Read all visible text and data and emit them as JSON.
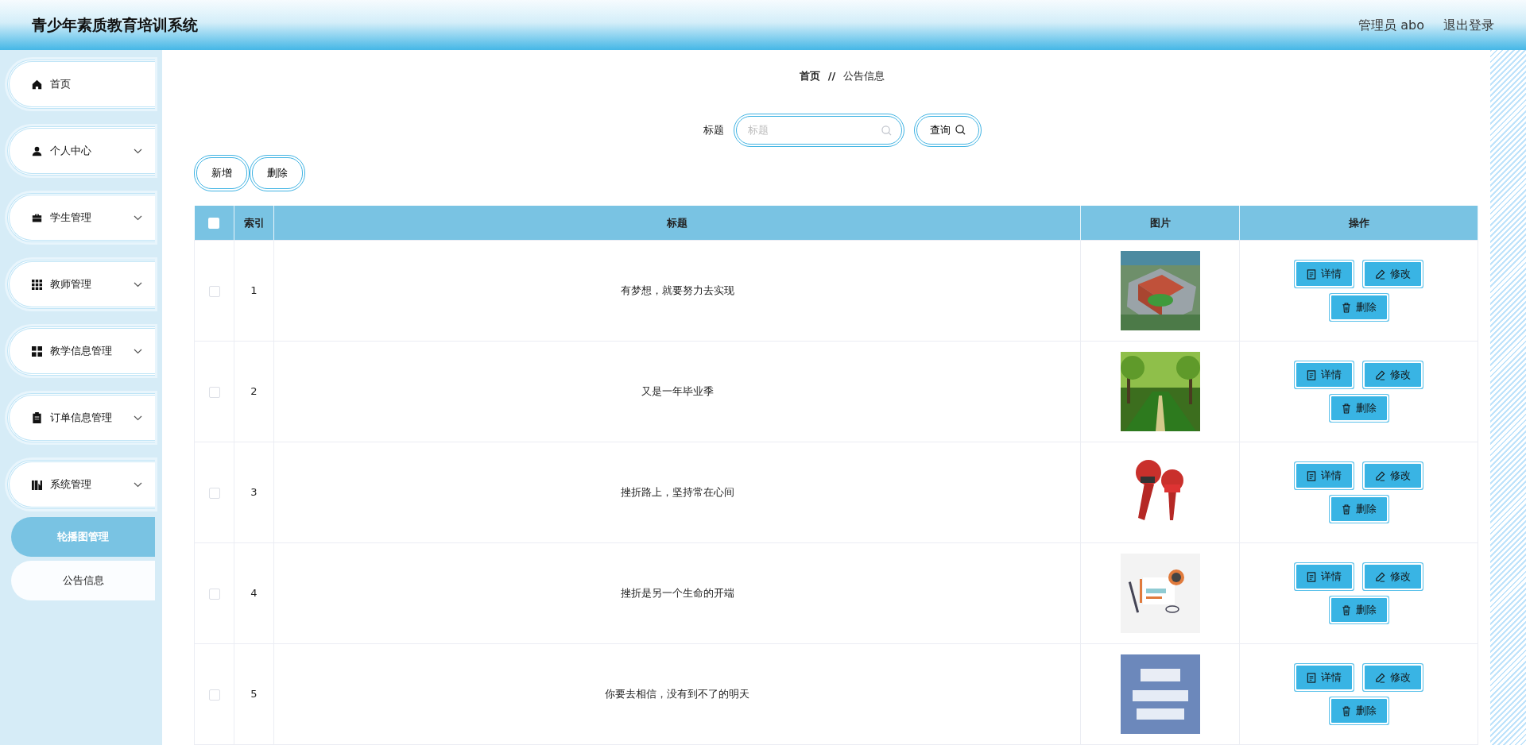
{
  "header": {
    "title": "青少年素质教育培训系统",
    "user": "管理员 abo",
    "logout": "退出登录"
  },
  "sidebar": {
    "items": [
      {
        "label": "首页",
        "kind": "link"
      },
      {
        "label": "个人中心",
        "kind": "menu"
      },
      {
        "label": "学生管理",
        "kind": "menu"
      },
      {
        "label": "教师管理",
        "kind": "menu"
      },
      {
        "label": "教学信息管理",
        "kind": "menu"
      },
      {
        "label": "订单信息管理",
        "kind": "menu"
      },
      {
        "label": "系统管理",
        "kind": "menu",
        "children": [
          {
            "label": "轮播图管理",
            "selected": true
          },
          {
            "label": "公告信息",
            "selected": false
          }
        ]
      }
    ]
  },
  "breadcrumb": {
    "items": [
      "首页",
      "公告信息"
    ],
    "separator": "//"
  },
  "search": {
    "label": "标题",
    "placeholder": "标题",
    "button": "查询"
  },
  "toolbar": {
    "buttons": [
      "新增",
      "删除"
    ]
  },
  "table": {
    "select_all": {
      "checked": false
    },
    "columns": [
      "索引",
      "标题",
      "图片",
      "操作"
    ],
    "rows": [
      {
        "checked": false,
        "index": "1",
        "title": "有梦想，就要努力去实现",
        "picture": {
          "kind": "picture"
        },
        "actions": [
          "详情",
          "修改",
          "删除"
        ]
      },
      {
        "checked": false,
        "index": "2",
        "title": "又是一年毕业季",
        "picture": {
          "kind": "picture"
        },
        "actions": [
          "详情",
          "修改",
          "删除"
        ]
      },
      {
        "checked": false,
        "index": "3",
        "title": "挫折路上，坚持常在心间",
        "picture": {
          "kind": "picture"
        },
        "actions": [
          "详情",
          "修改",
          "删除"
        ]
      },
      {
        "checked": false,
        "index": "4",
        "title": "挫折是另一个生命的开端",
        "picture": {
          "kind": "picture"
        },
        "actions": [
          "详情",
          "修改",
          "删除"
        ]
      },
      {
        "checked": false,
        "index": "5",
        "title": "你要去相信，没有到不了的明天",
        "picture": {
          "kind": "picture"
        },
        "actions": [
          "详情",
          "修改",
          "删除"
        ]
      }
    ]
  }
}
